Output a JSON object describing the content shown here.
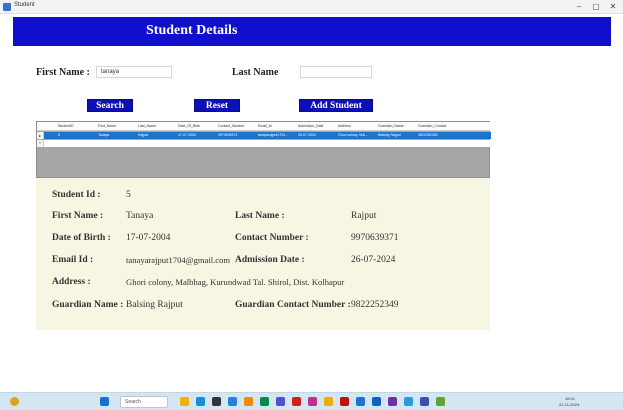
{
  "window": {
    "title": "Student",
    "minimize": "–",
    "maximize": "▢",
    "close": "✕"
  },
  "header": {
    "title": "Student Details"
  },
  "search_form": {
    "first_name_label": "First Name :",
    "first_name_value": "tanaya",
    "last_name_label": "Last Name",
    "last_name_value": ""
  },
  "buttons": {
    "search": "Search",
    "reset": "Reset",
    "add_student": "Add Student"
  },
  "grid": {
    "columns": [
      "StudentID",
      "First_Name",
      "Last_Name",
      "Date_Of_Birth",
      "Contact_Number",
      "Email_Id",
      "Admission_Date",
      "Address",
      "Guardian_Name",
      "Guardian_Contact"
    ],
    "row_indicator": "▸",
    "new_row_indicator": "*",
    "rows": [
      [
        "5",
        "Tanaya",
        "Rajput",
        "17-07-2004",
        "9970639371",
        "tanayarajput1704...",
        "26-07-2024",
        "Ghori colony, Mal...",
        "Balsing Rajput",
        "9822252349"
      ]
    ]
  },
  "details": {
    "student_id_label": "Student Id :",
    "student_id_value": "5",
    "first_name_label": "First Name :",
    "first_name_value": "Tanaya",
    "last_name_label": "Last Name :",
    "last_name_value": "Rajput",
    "dob_label": "Date of Birth :",
    "dob_value": "17-07-2004",
    "contact_label": "Contact Number :",
    "contact_value": "9970639371",
    "email_label": "Email Id :",
    "email_value": "tanayarajput1704@gmail.com",
    "admission_label": "Admission Date :",
    "admission_value": "26-07-2024",
    "address_label": "Address :",
    "address_value": "Ghori colony, Malbhag, Kurundwad Tal. Shirol, Dist. Kolhapur",
    "guardian_name_label": "Guardian Name :",
    "guardian_name_value": "Balsing Rajput",
    "guardian_contact_label": "Guardian Contact Number :",
    "guardian_contact_value": "9822252349"
  },
  "taskbar": {
    "search_placeholder": "Search",
    "time": "18:01",
    "date": "22-11-2024",
    "colors": {
      "bar": "#d4e6f2",
      "accent": "#1010cc"
    }
  }
}
